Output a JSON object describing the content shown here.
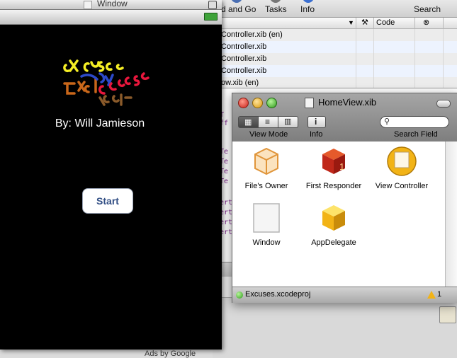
{
  "simulator": {
    "title": "Window",
    "logo_text": "excuses",
    "byline": "By: Will Jamieson",
    "start_label": "Start",
    "ads_text": "Ads by Google"
  },
  "xcode": {
    "toolbar": {
      "build_label": "d and Go",
      "tasks_label": "Tasks",
      "info_label": "Info",
      "search_label": "Search"
    },
    "columns": {
      "code": "Code"
    },
    "rows": [
      "Controller.xib (en)",
      "Controller.xib",
      "Controller.xib",
      "Controller.xib",
      "ow.xib (en)"
    ],
    "code_fragments": [
      "T",
      "ff",
      "Te",
      "Te",
      "Te",
      "Te",
      "ert",
      "ert",
      "ert",
      "ert"
    ]
  },
  "ib": {
    "title": "HomeView.xib",
    "view_mode_label": "View Mode",
    "info_label": "Info",
    "search_field_label": "Search Field",
    "objects": [
      {
        "label": "File's Owner",
        "icon": "transparent-cube-icon"
      },
      {
        "label": "First Responder",
        "icon": "red-cube-icon"
      },
      {
        "label": "View Controller",
        "icon": "view-controller-icon"
      },
      {
        "label": "Window",
        "icon": "window-icon"
      },
      {
        "label": "AppDelegate",
        "icon": "yellow-cube-icon"
      }
    ],
    "status_text": "Excuses.xcodeproj",
    "warning_count": "1"
  },
  "colors": {
    "accent": "#324f85",
    "status_green": "#2f9a1b",
    "warning": "#f2b316"
  }
}
